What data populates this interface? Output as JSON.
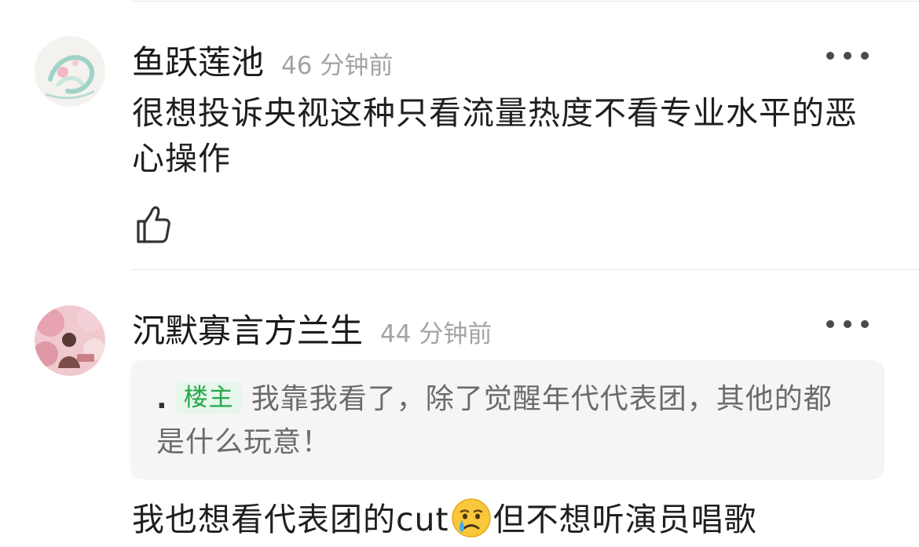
{
  "comments": [
    {
      "username": "鱼跃莲池",
      "timestamp": "46 分钟前",
      "content": "很想投诉央视这种只看流量热度不看专业水平的恶心操作"
    },
    {
      "username": "沉默寡言方兰生",
      "timestamp": "44 分钟前",
      "quote": {
        "author": ".",
        "badge": "楼主",
        "text": "我靠我看了，除了觉醒年代代表团，其他的都是什么玩意！"
      },
      "content_before_emoji": "我也想看代表团的cut",
      "content_after_emoji": "但不想听演员唱歌"
    }
  ],
  "icons": {
    "more": "more-dots-icon",
    "like": "thumbs-up-icon",
    "emoji": "crying-face-icon"
  },
  "colors": {
    "badge_bg": "#e6f6ea",
    "badge_text": "#24a849",
    "timestamp": "#a3a3a3",
    "quote_bg": "#f5f5f5"
  }
}
